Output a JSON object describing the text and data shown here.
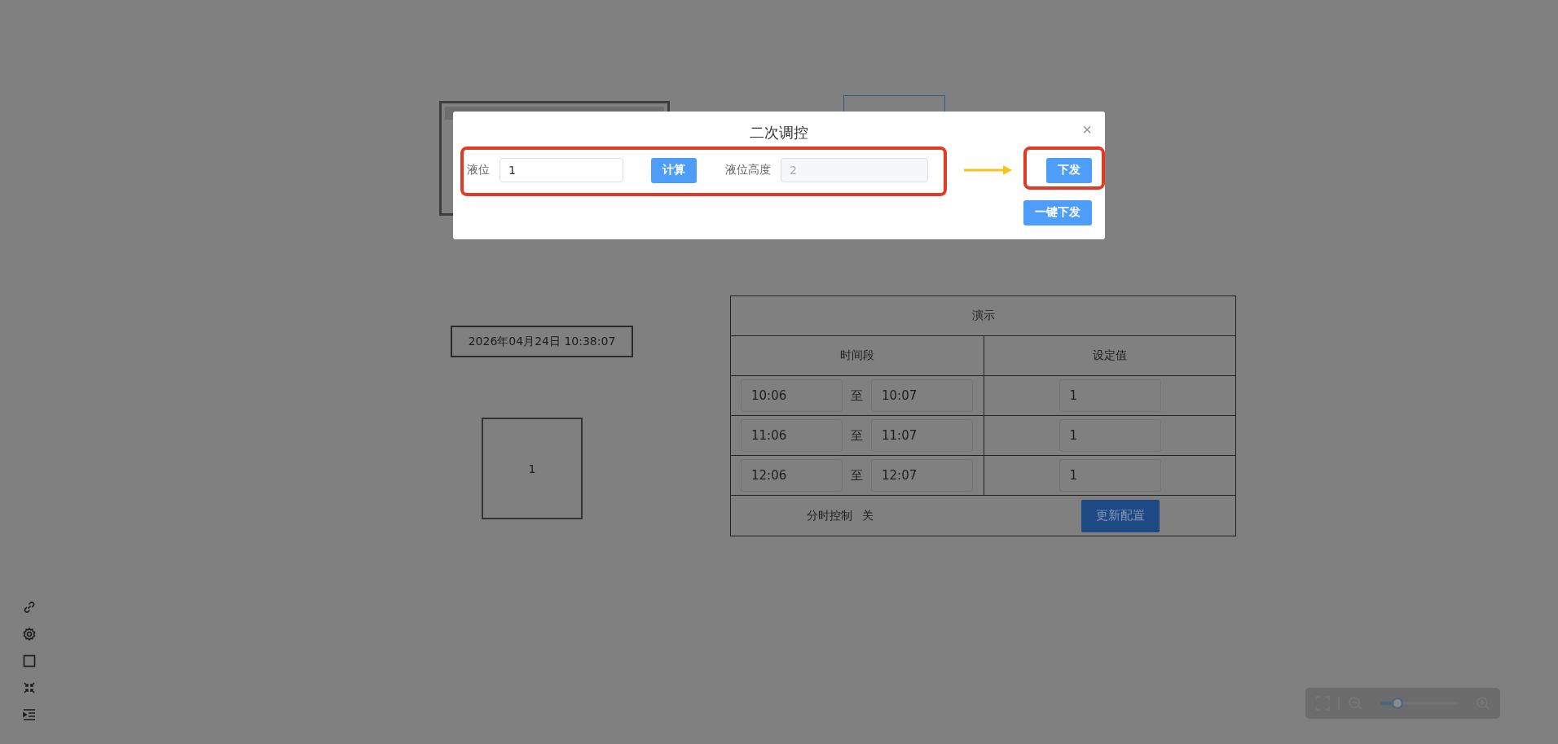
{
  "datetime": "2026年04月24日 10:38:07",
  "value_box": "1",
  "table": {
    "title": "演示",
    "columns": [
      "时间段",
      "设定值"
    ],
    "rows": [
      {
        "start": "10:06",
        "separator": "至",
        "end": "10:07",
        "value": "1"
      },
      {
        "start": "11:06",
        "separator": "至",
        "end": "11:07",
        "value": "1"
      },
      {
        "start": "12:06",
        "separator": "至",
        "end": "12:07",
        "value": "1"
      }
    ],
    "footer": {
      "label": "分时控制",
      "state": "关",
      "button": "更新配置"
    }
  },
  "zoom_control": {
    "level": 0.22
  },
  "dialog": {
    "title": "二次调控",
    "close": "×",
    "row": [
      {
        "kind": "field",
        "label": "液位",
        "value": "1",
        "disabled": false
      },
      {
        "kind": "button",
        "label": "计算"
      },
      {
        "kind": "field",
        "label": "液位高度",
        "value": "2",
        "disabled": true
      }
    ],
    "send_button": "下发",
    "send_all_button": "一键下发"
  }
}
